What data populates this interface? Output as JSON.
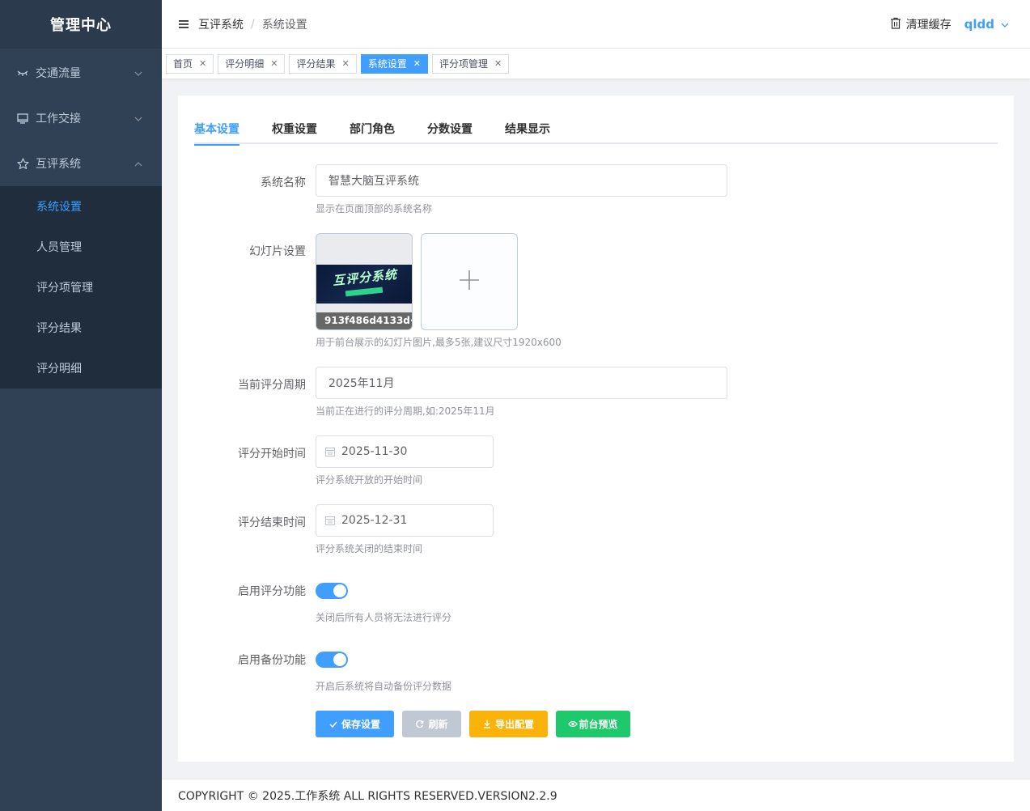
{
  "sidebar": {
    "title": "管理中心",
    "menus": [
      {
        "label": "交通流量",
        "icon": "eye-closed-icon"
      },
      {
        "label": "工作交接",
        "icon": "monitor-icon"
      },
      {
        "label": "互评系统",
        "icon": "star-icon"
      }
    ],
    "submenu": [
      {
        "label": "系统设置",
        "active": true
      },
      {
        "label": "人员管理"
      },
      {
        "label": "评分项管理"
      },
      {
        "label": "评分结果"
      },
      {
        "label": "评分明细"
      }
    ]
  },
  "header": {
    "breadcrumb": [
      "互评系统",
      "系统设置"
    ],
    "clear_cache": "清理缓存",
    "user": "qldd"
  },
  "tags": [
    {
      "label": "首页",
      "active": false
    },
    {
      "label": "评分明细",
      "active": false
    },
    {
      "label": "评分结果",
      "active": false
    },
    {
      "label": "系统设置",
      "active": true
    },
    {
      "label": "评分项管理",
      "active": false
    }
  ],
  "tabs": [
    "基本设置",
    "权重设置",
    "部门角色",
    "分数设置",
    "结果显示"
  ],
  "form": {
    "system_name": {
      "label": "系统名称",
      "value": "智慧大脑互评系统",
      "hint": "显示在页面顶部的系统名称"
    },
    "slides": {
      "label": "幻灯片设置",
      "file_name": "913f486d4133d···",
      "hint": "用于前台展示的幻灯片图片,最多5张,建议尺寸1920x600",
      "banner_title": "互评分系统"
    },
    "period": {
      "label": "当前评分周期",
      "value": "2025年11月",
      "hint": "当前正在进行的评分周期,如:2025年11月"
    },
    "start_time": {
      "label": "评分开始时间",
      "value": "2025-11-30",
      "hint": "评分系统开放的开始时间"
    },
    "end_time": {
      "label": "评分结束时间",
      "value": "2025-12-31",
      "hint": "评分系统关闭的结束时间"
    },
    "enable_scoring": {
      "label": "启用评分功能",
      "on": true,
      "hint": "关闭后所有人员将无法进行评分"
    },
    "enable_backup": {
      "label": "启用备份功能",
      "on": true,
      "hint": "开启后系统将自动备份评分数据"
    }
  },
  "buttons": {
    "save": "保存设置",
    "refresh": "刷新",
    "export": "导出配置",
    "preview": "前台预览"
  },
  "colors": {
    "primary": "#409eff",
    "sidebar": "#304156",
    "warning": "#f9b30a",
    "success": "#1dc96a"
  },
  "footer": "COPYRIGHT © 2025.工作系统 ALL RIGHTS RESERVED.VERSION2.2.9"
}
